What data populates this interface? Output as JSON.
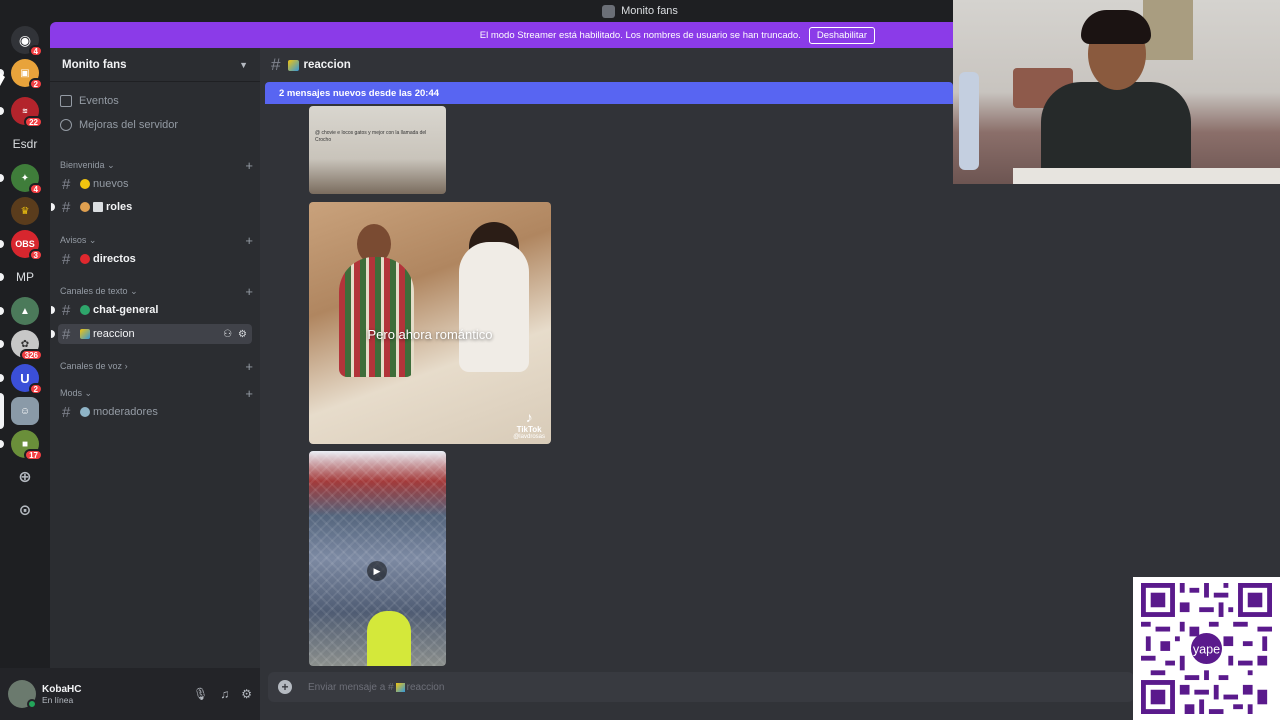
{
  "window": {
    "title": "Monito fans"
  },
  "streamer_banner": {
    "message": "El modo Streamer está habilitado. Los nombres de usuario se han truncado.",
    "button": "Deshabilitar"
  },
  "colors": {
    "blurple": "#5865f2",
    "streamer": "#8b3be8",
    "online": "#23a55a",
    "mention": "#f23f43"
  },
  "rail": {
    "servers": [
      {
        "name": "home",
        "icon": "discord-icon",
        "badge": "4"
      },
      {
        "name": "server-orange",
        "badge": "2"
      },
      {
        "name": "server-red-logo",
        "badge": "22"
      },
      {
        "name": "server-esdr",
        "label": "Esdr"
      },
      {
        "name": "server-game",
        "badge": "4"
      },
      {
        "name": "server-crown"
      },
      {
        "name": "server-obs",
        "label": "OBS",
        "badge": "3"
      },
      {
        "name": "server-mp",
        "label": "MP"
      },
      {
        "name": "server-landscape"
      },
      {
        "name": "server-creature",
        "badge": "326"
      },
      {
        "name": "server-u",
        "label": "U",
        "badge": "2"
      },
      {
        "name": "server-monito-fans"
      },
      {
        "name": "server-minecraft",
        "badge": "17"
      }
    ]
  },
  "sidebar": {
    "guild_name": "Monito fans",
    "menu": [
      {
        "label": "Eventos",
        "icon": "calendar-icon"
      },
      {
        "label": "Mejoras del servidor",
        "icon": "boost-icon"
      }
    ],
    "categories": [
      {
        "label": "Bienvenida"
      },
      {
        "label": "Avisos"
      },
      {
        "label": "Canales de texto"
      },
      {
        "label": "Canales de voz"
      },
      {
        "label": "Mods"
      }
    ],
    "channels": [
      {
        "label": "nuevos"
      },
      {
        "label": "roles"
      },
      {
        "label": "directos"
      },
      {
        "label": "chat-general"
      },
      {
        "label": "reaccion"
      },
      {
        "label": "moderadores"
      }
    ]
  },
  "user": {
    "name": "KobaHC",
    "status": "En línea"
  },
  "chat": {
    "channel": "reaccion",
    "new_messages_bar": "2 mensajes nuevos desde las 20:44",
    "media": {
      "clip1_caption": "@ chovie e locos gatos y mejor con la llamada del Crocho",
      "clip2_overlay": "Pero ahora romántico",
      "clip2_brand": "TikTok",
      "clip2_user": "@lavdrosas"
    },
    "composer_placeholder_prefix": "Enviar mensaje a #",
    "composer_placeholder_channel": "reaccion"
  },
  "overlays": {
    "qr_brand": "yape"
  }
}
